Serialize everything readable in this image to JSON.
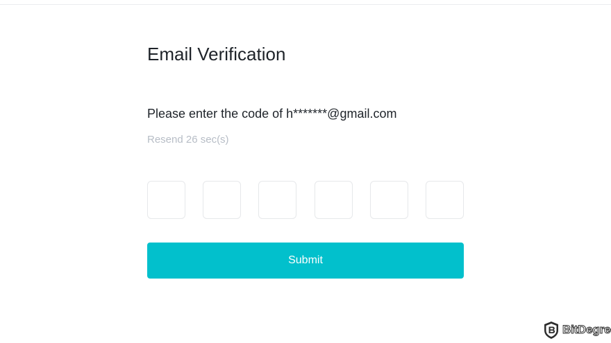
{
  "page": {
    "title": "Email Verification"
  },
  "prompt": {
    "text": "Please enter the code of",
    "email": "h*******@gmail.com"
  },
  "resend": {
    "label": "Resend 26 sec(s)"
  },
  "code_inputs": [
    "",
    "",
    "",
    "",
    "",
    ""
  ],
  "submit": {
    "label": "Submit"
  },
  "watermark": {
    "brand": "BitDegree",
    "icon": "bitdegree-shield-logo"
  },
  "colors": {
    "accent": "#02c0cc",
    "text_primary": "#1e2329",
    "text_muted": "#b7bdc6",
    "input_border": "#e6e8ea"
  }
}
